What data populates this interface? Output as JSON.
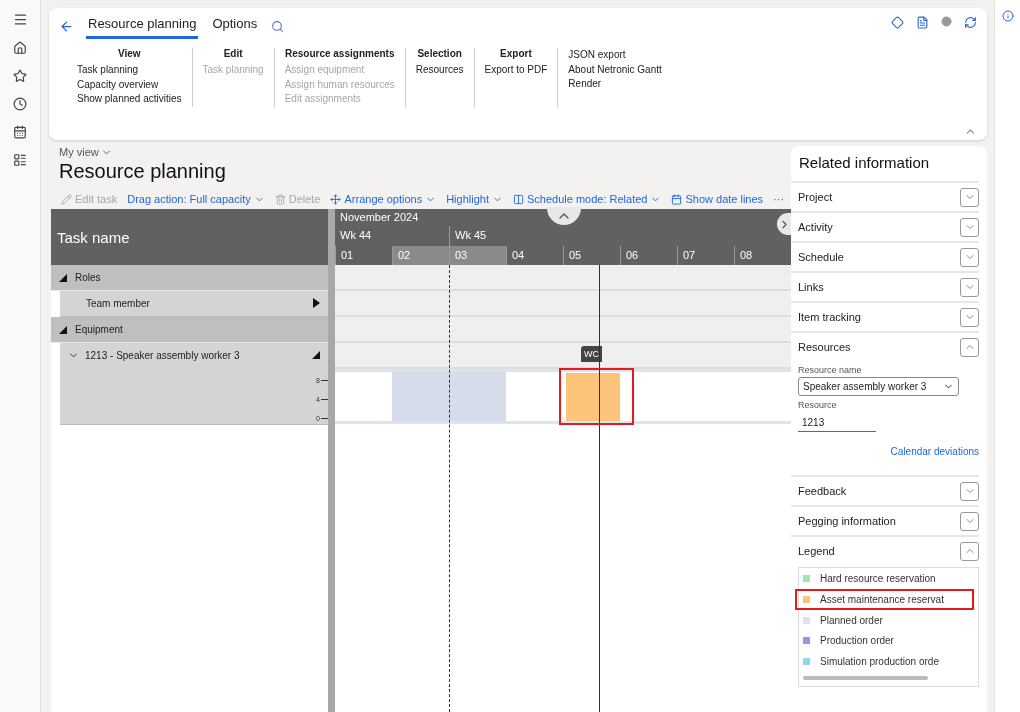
{
  "ribbon": {
    "tabs": [
      {
        "label": "Resource planning",
        "selected": true
      },
      {
        "label": "Options",
        "selected": false
      }
    ],
    "groups": [
      {
        "title": "View",
        "items": [
          {
            "label": "Task planning",
            "disabled": false
          },
          {
            "label": "Capacity overview",
            "disabled": false
          },
          {
            "label": "Show planned activities",
            "disabled": false
          }
        ]
      },
      {
        "title": "Edit",
        "items": [
          {
            "label": "Task planning",
            "disabled": true
          }
        ]
      },
      {
        "title": "Resource assignments",
        "items": [
          {
            "label": "Assign equipment",
            "disabled": true
          },
          {
            "label": "Assign human resources",
            "disabled": true
          },
          {
            "label": "Edit assignments",
            "disabled": true
          }
        ]
      },
      {
        "title": "Selection",
        "items": [
          {
            "label": "Resources",
            "disabled": false
          }
        ]
      },
      {
        "title": "Export",
        "items": [
          {
            "label": "Export to PDF",
            "disabled": false
          }
        ]
      },
      {
        "items": [
          {
            "label": "JSON export",
            "disabled": false
          },
          {
            "label": "About Netronic Gantt",
            "disabled": false
          },
          {
            "label": "Render",
            "disabled": false
          }
        ]
      }
    ]
  },
  "page": {
    "view": "My view",
    "title": "Resource planning"
  },
  "toolbar": [
    {
      "kind": "edit",
      "label": "Edit task",
      "disabled": true
    },
    {
      "kind": "dropdown",
      "label": "Drag action: Full capacity",
      "disabled": false
    },
    {
      "kind": "delete",
      "label": "Delete",
      "disabled": true
    },
    {
      "kind": "arrange",
      "label": "Arrange options",
      "disabled": false
    },
    {
      "kind": "dropdown",
      "label": "Highlight",
      "disabled": false
    },
    {
      "kind": "schedule",
      "label": "Schedule mode: Related",
      "disabled": false
    },
    {
      "kind": "calendar",
      "label": "Show date lines",
      "disabled": false
    },
    {
      "kind": "more",
      "label": "···",
      "disabled": false
    }
  ],
  "gantt": {
    "column": "Task name",
    "month": "November 2024",
    "weeks": [
      {
        "label": "Wk 44",
        "days": [
          {
            "label": "01",
            "weekend": false
          },
          {
            "label": "02",
            "weekend": true
          }
        ]
      },
      {
        "label": "Wk 45",
        "days": [
          {
            "label": "03",
            "weekend": true
          },
          {
            "label": "04",
            "weekend": false
          },
          {
            "label": "05",
            "weekend": false,
            "now": true,
            "booking": {
              "tag": "WC",
              "highlighted": true
            }
          },
          {
            "label": "06",
            "weekend": false
          },
          {
            "label": "07",
            "weekend": false
          },
          {
            "label": "08",
            "weekend": false
          }
        ]
      }
    ],
    "rows": [
      {
        "label": "Roles",
        "expanded": true,
        "children": [
          {
            "label": "Team member",
            "expanded": false
          }
        ]
      },
      {
        "label": "Equipment",
        "expanded": true,
        "children": [
          {
            "label": "1213 - Speaker assembly worker 3",
            "expanded": true,
            "ticks": [
              "8",
              "4",
              "0"
            ]
          }
        ]
      }
    ]
  },
  "related": {
    "title": "Related information",
    "sections": [
      {
        "kind": "plain",
        "label": "Project",
        "expanded": false
      },
      {
        "kind": "plain",
        "label": "Activity",
        "expanded": false
      },
      {
        "kind": "plain",
        "label": "Schedule",
        "expanded": false
      },
      {
        "kind": "plain",
        "label": "Links",
        "expanded": false
      },
      {
        "kind": "plain",
        "label": "Item tracking",
        "expanded": false
      },
      {
        "kind": "resources",
        "label": "Resources",
        "expanded": true,
        "name_label": "Resource name",
        "name_value": "Speaker assembly worker 3",
        "resource_label": "Resource",
        "resource_value": "1213",
        "link": "Calendar deviations"
      },
      {
        "kind": "plain",
        "label": "Feedback",
        "expanded": false
      },
      {
        "kind": "plain",
        "label": "Pegging information",
        "expanded": false
      },
      {
        "kind": "legend",
        "label": "Legend",
        "expanded": true,
        "items": [
          {
            "label": "Hard resource reservation",
            "color": "#9ee6b0",
            "highlighted": false
          },
          {
            "label": "Asset maintenance reservat",
            "color": "#fbc47a",
            "highlighted": true
          },
          {
            "label": "Planned order",
            "color": "#e6dcf7",
            "highlighted": false
          },
          {
            "label": "Production order",
            "color": "#a98bea",
            "highlighted": false
          },
          {
            "label": "Simulation production orde",
            "color": "#8fd7ea",
            "highlighted": false
          }
        ]
      }
    ]
  }
}
